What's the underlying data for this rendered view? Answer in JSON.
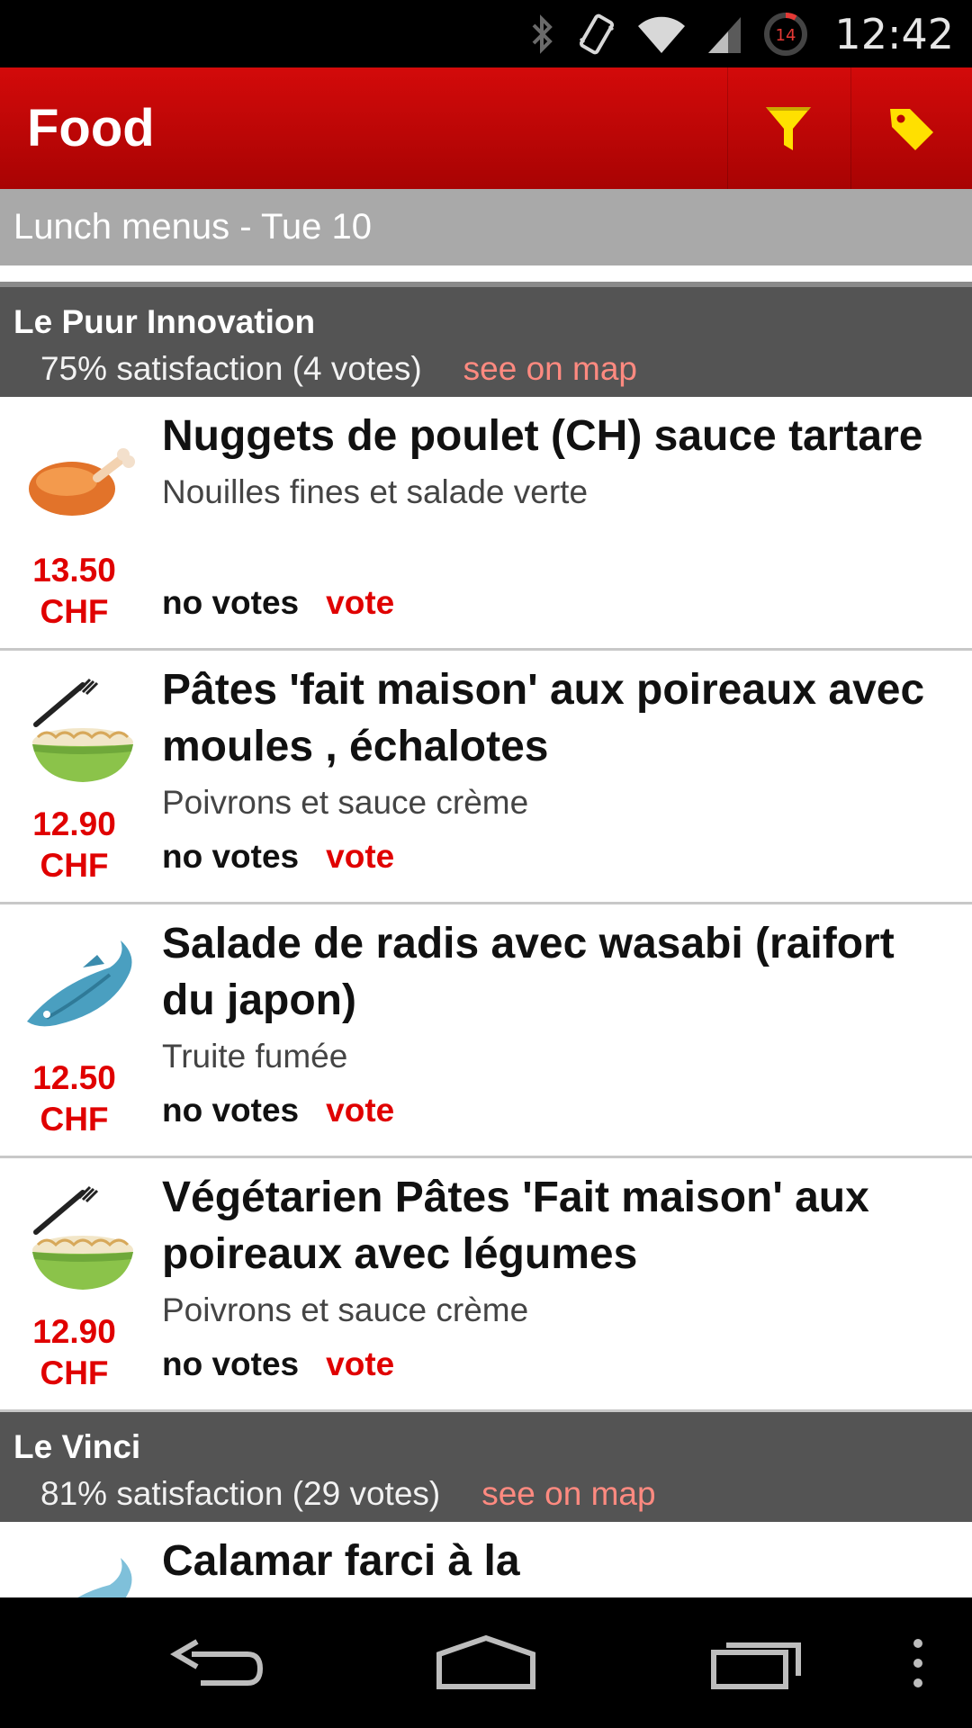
{
  "status_bar": {
    "time": "12:42",
    "battery_level": "14",
    "icons": [
      "bluetooth-icon",
      "vibrate-icon",
      "wifi-icon",
      "signal-icon",
      "battery-icon"
    ]
  },
  "action_bar": {
    "title": "Food",
    "actions": [
      "filter-icon",
      "tag-icon"
    ],
    "accent_color": "#c00000"
  },
  "subheader": {
    "text": "Lunch menus - Tue 10"
  },
  "restaurants": [
    {
      "name": "Le Puur Innovation",
      "satisfaction": "75% satisfaction (4 votes)",
      "map_link": "see on map",
      "items": [
        {
          "icon": "chicken-icon",
          "price": "13.50",
          "currency": "CHF",
          "dish": "Nuggets de poulet (CH) sauce tartare",
          "description": "Nouilles fines et salade verte",
          "votes": "no votes",
          "vote_label": "vote"
        },
        {
          "icon": "pasta-bowl-icon",
          "price": "12.90",
          "currency": "CHF",
          "dish": "Pâtes 'fait maison' aux poireaux avec moules , échalotes",
          "description": "Poivrons et sauce crème",
          "votes": "no votes",
          "vote_label": "vote"
        },
        {
          "icon": "fish-icon",
          "price": "12.50",
          "currency": "CHF",
          "dish": "Salade de radis avec wasabi (raifort du japon)",
          "description": "Truite fumée",
          "votes": "no votes",
          "vote_label": "vote"
        },
        {
          "icon": "pasta-bowl-icon",
          "price": "12.90",
          "currency": "CHF",
          "dish": "Végétarien Pâtes 'Fait maison' aux poireaux avec légumes",
          "description": "Poivrons et sauce crème",
          "votes": "no votes",
          "vote_label": "vote"
        }
      ]
    },
    {
      "name": "Le Vinci",
      "satisfaction": "81% satisfaction (29 votes)",
      "map_link": "see on map",
      "items": [
        {
          "icon": "fish-icon",
          "dish": "Calamar farci à la"
        }
      ]
    }
  ],
  "nav_bar": {
    "buttons": [
      "back-icon",
      "home-icon",
      "recent-apps-icon",
      "menu-overflow-icon"
    ]
  }
}
